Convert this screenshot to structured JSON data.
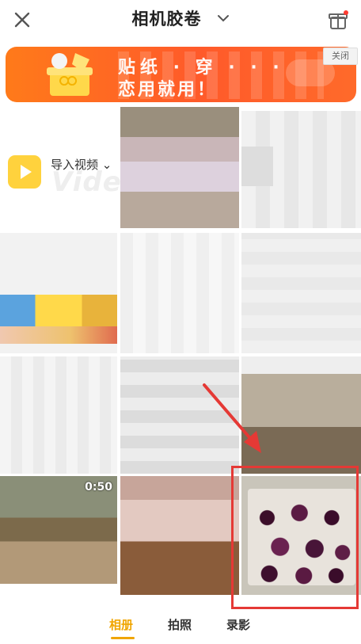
{
  "header": {
    "title": "相机胶卷",
    "close_icon": "close-icon",
    "dropdown_icon": "chevron-down-icon",
    "gift_icon": "gift-icon"
  },
  "banner": {
    "line1": "贴纸 · 穿 · · ·",
    "line2": "恋用就用！",
    "close_label": "关闭",
    "accent": "#ff6a2a"
  },
  "import": {
    "label": "导入视频",
    "watermark": "Video",
    "icon": "play-icon"
  },
  "gallery": {
    "video_duration": "0:50",
    "selected_highlight_color": "#e53935"
  },
  "tabs": [
    {
      "label": "相册",
      "active": true
    },
    {
      "label": "拍照",
      "active": false
    },
    {
      "label": "录影",
      "active": false
    }
  ]
}
